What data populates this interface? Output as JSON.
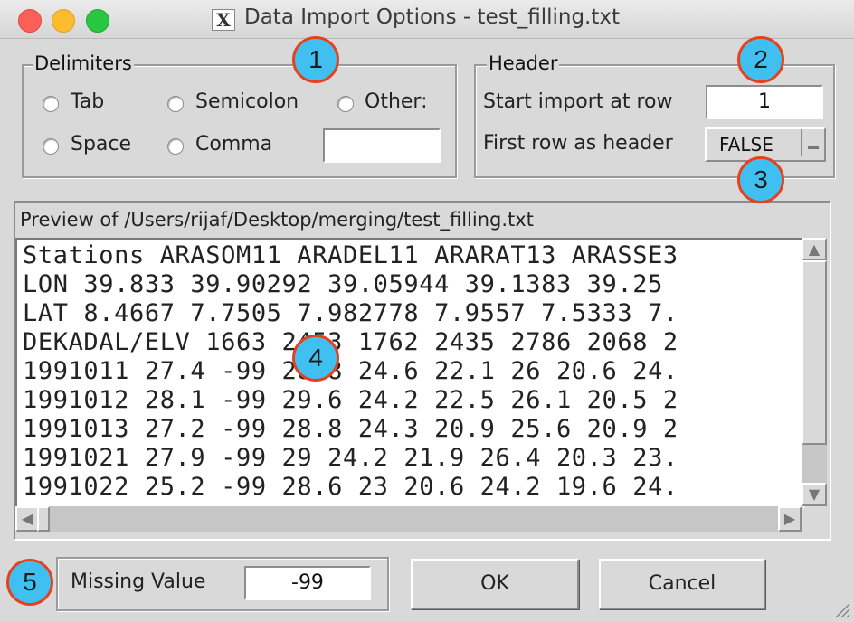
{
  "window": {
    "title": "Data Import Options -  test_filling.txt",
    "app_icon": "X"
  },
  "delimiters": {
    "legend": "Delimiters",
    "options": [
      "Tab",
      "Semicolon",
      "Other:",
      "Space",
      "Comma"
    ],
    "other_value": ""
  },
  "header": {
    "legend": "Header",
    "start_row_label": "Start import at row",
    "start_row_value": "1",
    "first_row_label": "First row as header",
    "first_row_value": "FALSE"
  },
  "preview": {
    "label": "Preview of  /Users/rijaf/Desktop/merging/test_filling.txt",
    "lines": [
      "Stations ARASOM11 ARADEL11 ARARAT13 ARASSE3",
      "LON 39.833 39.90292 39.05944 39.1383 39.25",
      "LAT 8.4667 7.7505 7.982778 7.9557 7.5333 7.",
      "DEKADAL/ELV 1663 2453 1762 2435 2786 2068 2",
      "1991011 27.4 -99 28.8 24.6 22.1 26 20.6 24.",
      "1991012 28.1 -99 29.6 24.2 22.5 26.1 20.5 2",
      "1991013 27.2 -99 28.8 24.3 20.9 25.6 20.9 2",
      "1991021 27.9 -99 29 24.2 21.9 26.4 20.3 23.",
      "1991022 25.2 -99 28.6 23 20.6 24.2 19.6 24."
    ]
  },
  "footer": {
    "missing_label": "Missing Value",
    "missing_value": "-99",
    "ok_label": "OK",
    "cancel_label": "Cancel"
  },
  "annotations": [
    "1",
    "2",
    "3",
    "4",
    "5"
  ],
  "colors": {
    "badge_fill": "#3fc0f0",
    "badge_border": "#e8401c",
    "window_bg": "#d9d9d9"
  }
}
